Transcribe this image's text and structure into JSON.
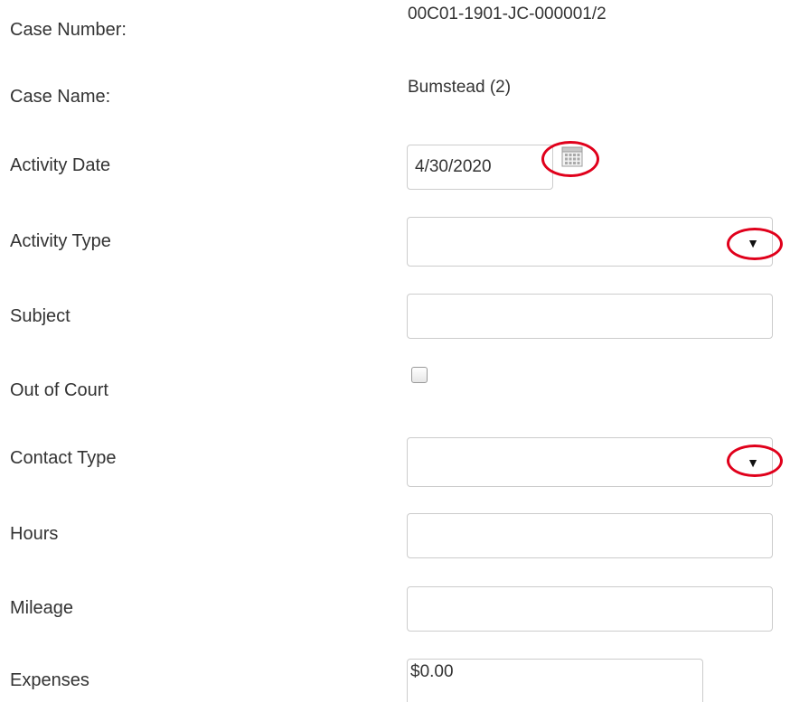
{
  "form": {
    "case_number": {
      "label": "Case Number:",
      "value": "00C01-1901-JC-000001/2"
    },
    "case_name": {
      "label": "Case Name:",
      "value": "Bumstead (2)"
    },
    "activity_date": {
      "label": "Activity Date",
      "value": "4/30/2020",
      "icon": "calendar-icon"
    },
    "activity_type": {
      "label": "Activity Type",
      "value": "",
      "icon": "triangle-down-icon",
      "arrow_glyph": "▼"
    },
    "subject": {
      "label": "Subject",
      "value": ""
    },
    "out_of_court": {
      "label": "Out of Court",
      "checked": false
    },
    "contact_type": {
      "label": "Contact Type",
      "value": "",
      "icon": "triangle-down-icon",
      "arrow_glyph": "▼"
    },
    "hours": {
      "label": "Hours",
      "value": ""
    },
    "mileage": {
      "label": "Mileage",
      "value": ""
    },
    "expenses": {
      "label": "Expenses",
      "value": "$0.00"
    }
  },
  "colors": {
    "text": "#333333",
    "border": "#cccccc",
    "annotation": "#e0001b"
  }
}
